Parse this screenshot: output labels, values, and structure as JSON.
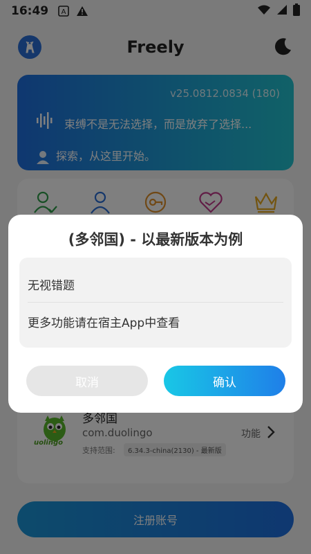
{
  "status_bar": {
    "time": "16:49",
    "icons": [
      "a-notification-icon",
      "warning-icon",
      "wifi-icon",
      "signal-icon",
      "battery-icon"
    ]
  },
  "header": {
    "title": "Freely",
    "logo_icon": "deer-icon",
    "theme_icon": "moon-icon"
  },
  "hero": {
    "version": "v25.0812.0834 (180)",
    "quote": "束缚不是无法选择，而是放弃了选择...",
    "explore_text": "探索，从这里开始。"
  },
  "features": {
    "icons": [
      "user-check-icon",
      "user-icon",
      "key-icon",
      "handshake-icon",
      "crown-icon"
    ],
    "colors": [
      "#2e9e4a",
      "#2a6fd6",
      "#e0902a",
      "#c23a8c",
      "#e6a81e"
    ]
  },
  "app": {
    "name": "多邻国",
    "package": "com.duolingo",
    "support_label": "支持范围:",
    "support_version": "6.34.3-china(2130) - 最新版",
    "function_label": "功能",
    "logo_text": "uolingo"
  },
  "register": {
    "label": "注册账号"
  },
  "dialog": {
    "title": "(多邻国) - 以最新版本为例",
    "items": [
      "无视错题",
      "更多功能请在宿主App中查看"
    ],
    "cancel_label": "取消",
    "confirm_label": "确认"
  }
}
